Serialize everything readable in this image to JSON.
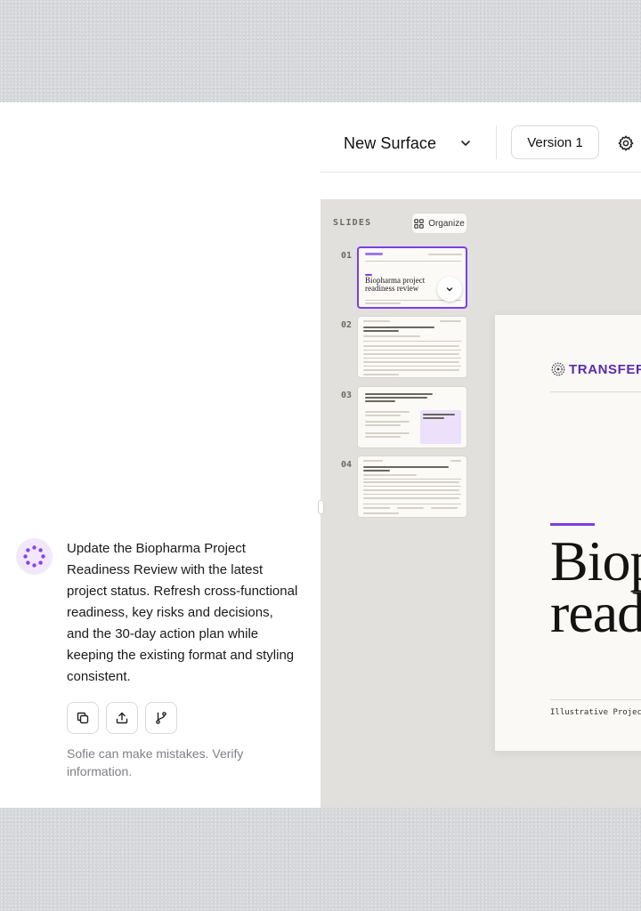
{
  "topbar": {
    "surface_title": "New Surface",
    "version_label": "Version 1"
  },
  "slides_panel": {
    "label": "SLIDES",
    "organize_label": "Organize",
    "slides": [
      {
        "number": "01",
        "thumb_title": "Biopharma project readiness review"
      },
      {
        "number": "02"
      },
      {
        "number": "03"
      },
      {
        "number": "04"
      }
    ]
  },
  "main_slide": {
    "brand": "TRANSFER",
    "title": "Biop\nread",
    "footer": "Illustrative Project"
  },
  "chat": {
    "message": "Update the Biopharma Project Readiness Review with the latest project status. Refresh cross-functional readiness, key risks and decisions, and the 30-day action plan while keeping the existing format and styling consistent.",
    "disclaimer": "Sofie can make mistakes. Verify information."
  },
  "colors": {
    "accent": "#7b3fe4",
    "brand": "#5a2bb0",
    "canvas": "#e2e0dc"
  }
}
